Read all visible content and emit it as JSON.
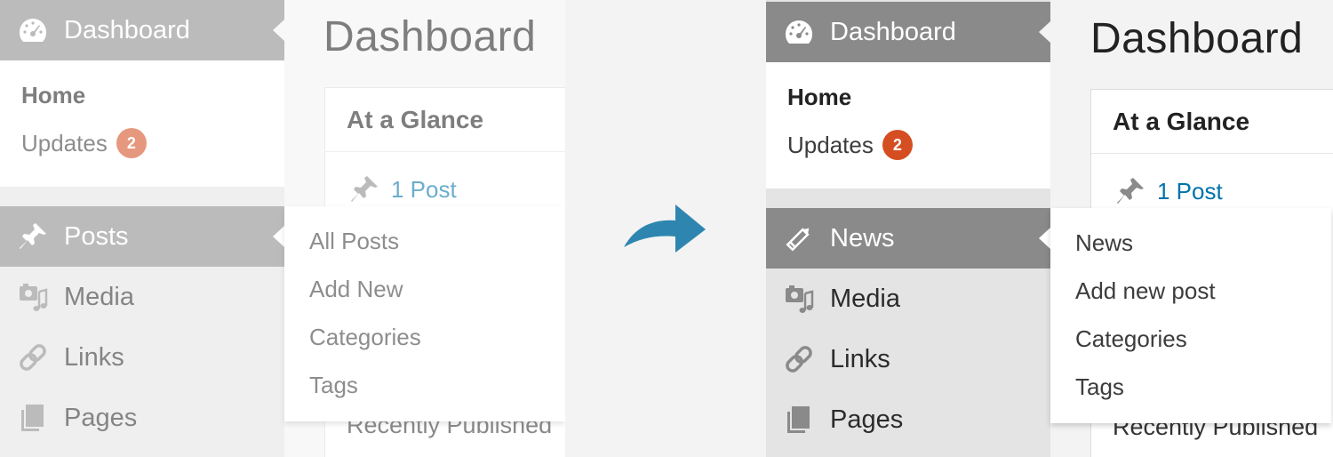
{
  "before": {
    "page_title": "Dashboard",
    "dashboard_label": "Dashboard",
    "submenu": {
      "home": "Home",
      "updates": "Updates",
      "updates_count": "2"
    },
    "posts_label": "Posts",
    "media_label": "Media",
    "links_label": "Links",
    "pages_label": "Pages",
    "flyout": [
      "All Posts",
      "Add New",
      "Categories",
      "Tags"
    ],
    "widget": {
      "title": "At a Glance",
      "post_count": "1 Post",
      "recent": "Recently Published"
    }
  },
  "after": {
    "page_title": "Dashboard",
    "dashboard_label": "Dashboard",
    "submenu": {
      "home": "Home",
      "updates": "Updates",
      "updates_count": "2"
    },
    "news_label": "News",
    "media_label": "Media",
    "links_label": "Links",
    "pages_label": "Pages",
    "flyout": [
      "News",
      "Add new post",
      "Categories",
      "Tags"
    ],
    "widget": {
      "title": "At a Glance",
      "post_count": "1 Post",
      "recent": "Recently Published"
    }
  },
  "colors": {
    "menu_current": "#8a8a8a",
    "sidebar_bg": "#e4e4e4",
    "badge": "#d54e21",
    "link": "#0073aa",
    "arrow": "#2e86b0"
  },
  "icons": [
    "dashboard-icon",
    "pin-icon",
    "pencil-icon",
    "media-icon",
    "link-icon",
    "pages-icon",
    "curved-arrow-icon"
  ]
}
